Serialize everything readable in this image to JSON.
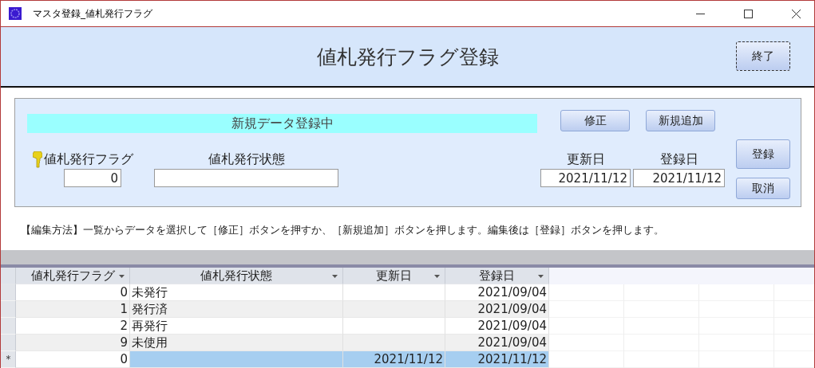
{
  "window": {
    "title": "マスタ登録_値札発行フラグ"
  },
  "header": {
    "title": "値札発行フラグ登録",
    "close_button": "終了"
  },
  "form": {
    "status": "新規データ登録中",
    "edit_button": "修正",
    "add_button": "新規追加",
    "save_button": "登録",
    "cancel_button": "取消",
    "fields": [
      {
        "kind": "key",
        "label": "値札発行フラグ",
        "value": "0"
      },
      {
        "kind": "text",
        "label": "値札発行状態"
      },
      {
        "kind": "date",
        "label": "更新日",
        "value": "2021/11/12"
      },
      {
        "kind": "date",
        "label": "登録日",
        "value": "2021/11/12"
      }
    ]
  },
  "instructions": "【編集方法】一覧からデータを選択して［修正］ボタンを押すか、［新規追加］ボタンを押します。編集後は［登録］ボタンを押します。",
  "table": {
    "columns": [
      "値札発行フラグ",
      "値札発行状態",
      "更新日",
      "登録日"
    ],
    "rows": [
      {
        "selected": false,
        "cells": [
          "0",
          "未発行",
          null,
          "2021/09/04"
        ]
      },
      {
        "selected": false,
        "cells": [
          "1",
          "発行済",
          null,
          "2021/09/04"
        ]
      },
      {
        "selected": false,
        "cells": [
          "2",
          "再発行",
          null,
          "2021/09/04"
        ]
      },
      {
        "selected": false,
        "cells": [
          "9",
          "未使用",
          null,
          "2021/09/04"
        ]
      },
      {
        "marker": "＊",
        "selected": true,
        "cells": [
          "0",
          null,
          "2021/11/12",
          "2021/11/12"
        ]
      }
    ]
  }
}
